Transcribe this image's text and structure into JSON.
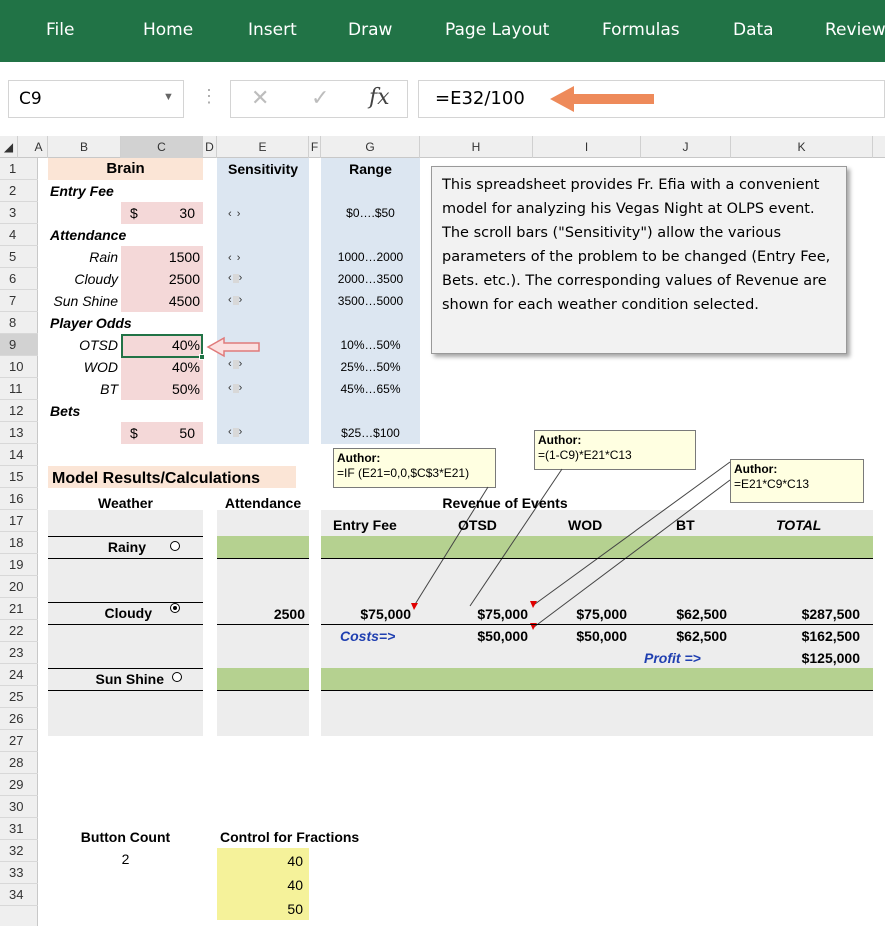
{
  "ribbon": {
    "tabs": [
      "File",
      "Home",
      "Insert",
      "Draw",
      "Page Layout",
      "Formulas",
      "Data",
      "Review"
    ]
  },
  "formula_bar": {
    "name_box": "C9",
    "cancel": "✕",
    "enter": "✓",
    "fx": "fx",
    "formula": "=E32/100"
  },
  "columns": [
    "A",
    "B",
    "C",
    "D",
    "E",
    "F",
    "G",
    "H",
    "I",
    "J",
    "K"
  ],
  "rows": [
    "1",
    "2",
    "3",
    "4",
    "5",
    "6",
    "7",
    "8",
    "9",
    "10",
    "11",
    "12",
    "13",
    "14",
    "15",
    "16",
    "17",
    "18",
    "19",
    "20",
    "21",
    "22",
    "23",
    "24",
    "25",
    "26",
    "27",
    "28",
    "29",
    "30",
    "31",
    "32",
    "33",
    "34"
  ],
  "brain": {
    "title": "Brain",
    "sensitivity": "Sensitivity",
    "range": "Range",
    "entry_fee_label": "Entry Fee",
    "entry_fee_currency": "$",
    "entry_fee_value": "30",
    "entry_fee_range": "$0….$50",
    "attendance_label": "Attendance",
    "rain_label": "Rain",
    "rain_value": "1500",
    "rain_range": "1000…2000",
    "cloudy_label": "Cloudy",
    "cloudy_value": "2500",
    "cloudy_range": "2000…3500",
    "sunshine_label": "Sun Shine",
    "sunshine_value": "4500",
    "sunshine_range": "3500…5000",
    "odds_label": "Player Odds",
    "otsd_label": "OTSD",
    "otsd_value": "40%",
    "otsd_range": "10%…50%",
    "wod_label": "WOD",
    "wod_value": "40%",
    "wod_range": "25%…50%",
    "bt_label": "BT",
    "bt_value": "50%",
    "bt_range": "45%…65%",
    "bets_label": "Bets",
    "bets_currency": "$",
    "bets_value": "50",
    "bets_range": "$25…$100"
  },
  "note_main": "This spreadsheet provides Fr. Efia with a convenient model for analyzing his Vegas Night at OLPS event.  The scroll bars (\"Sensitivity\") allow the various parameters of the problem to be changed (Entry Fee, Bets. etc.).  The corresponding values of Revenue are shown for each weather condition selected.",
  "comments": [
    {
      "author": "Author:",
      "text": "=IF (E21=0,0,$C$3*E21)"
    },
    {
      "author": "Author:",
      "text": "=(1-C9)*E21*C13"
    },
    {
      "author": "Author:",
      "text": "=E21*C9*C13"
    }
  ],
  "model": {
    "title": "Model Results/Calculations",
    "weather": "Weather",
    "attendance": "Attendance",
    "revenue": "Revenue of Events",
    "headers": [
      "Entry Fee",
      "OTSD",
      "WOD",
      "BT",
      "TOTAL"
    ],
    "rainy": "Rainy",
    "cloudy": "Cloudy",
    "sunshine": "Sun Shine",
    "cloudy_attendance": "2500",
    "revenue_row": [
      "$75,000",
      "$75,000",
      "$75,000",
      "$62,500",
      "$287,500"
    ],
    "costs_label": "Costs=>",
    "costs_row": [
      "$50,000",
      "$50,000",
      "$62,500",
      "$162,500"
    ],
    "profit_label": "Profit =>",
    "profit_value": "$125,000"
  },
  "controls": {
    "button_count_label": "Button Count",
    "button_count_value": "2",
    "fractions_label": "Control for Fractions",
    "fractions": [
      "40",
      "40",
      "50"
    ]
  },
  "colors": {
    "ribbon": "#217346",
    "peach": "#fbe5d6",
    "pink": "#f4d8d8",
    "blue_band": "#dce6f1",
    "green": "#b5d190",
    "gray_band": "#ededed",
    "yellow": "#f5f29a",
    "arrow": "#ee8a5a"
  }
}
